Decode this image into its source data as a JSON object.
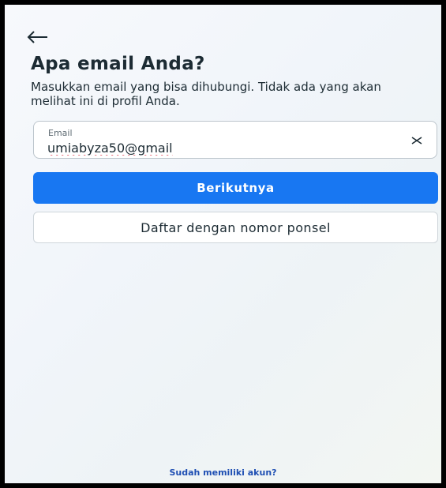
{
  "header": {
    "back_icon": "arrow-left-icon",
    "title": "Apa email Anda?",
    "subtitle": "Masukkan email yang bisa dihubungi. Tidak ada yang akan melihat ini di profil Anda."
  },
  "email_field": {
    "label": "Email",
    "value": "umiabyza50@gmail",
    "clear_icon": "close-icon"
  },
  "actions": {
    "next_label": "Berikutnya",
    "phone_signup_label": "Daftar dengan nomor ponsel"
  },
  "footer": {
    "login_link": "Sudah memiliki akun?"
  },
  "colors": {
    "primary": "#1877f2",
    "link": "#1f4fb3",
    "text": "#1c2b33",
    "spellcheck_underline": "#e0263a"
  }
}
